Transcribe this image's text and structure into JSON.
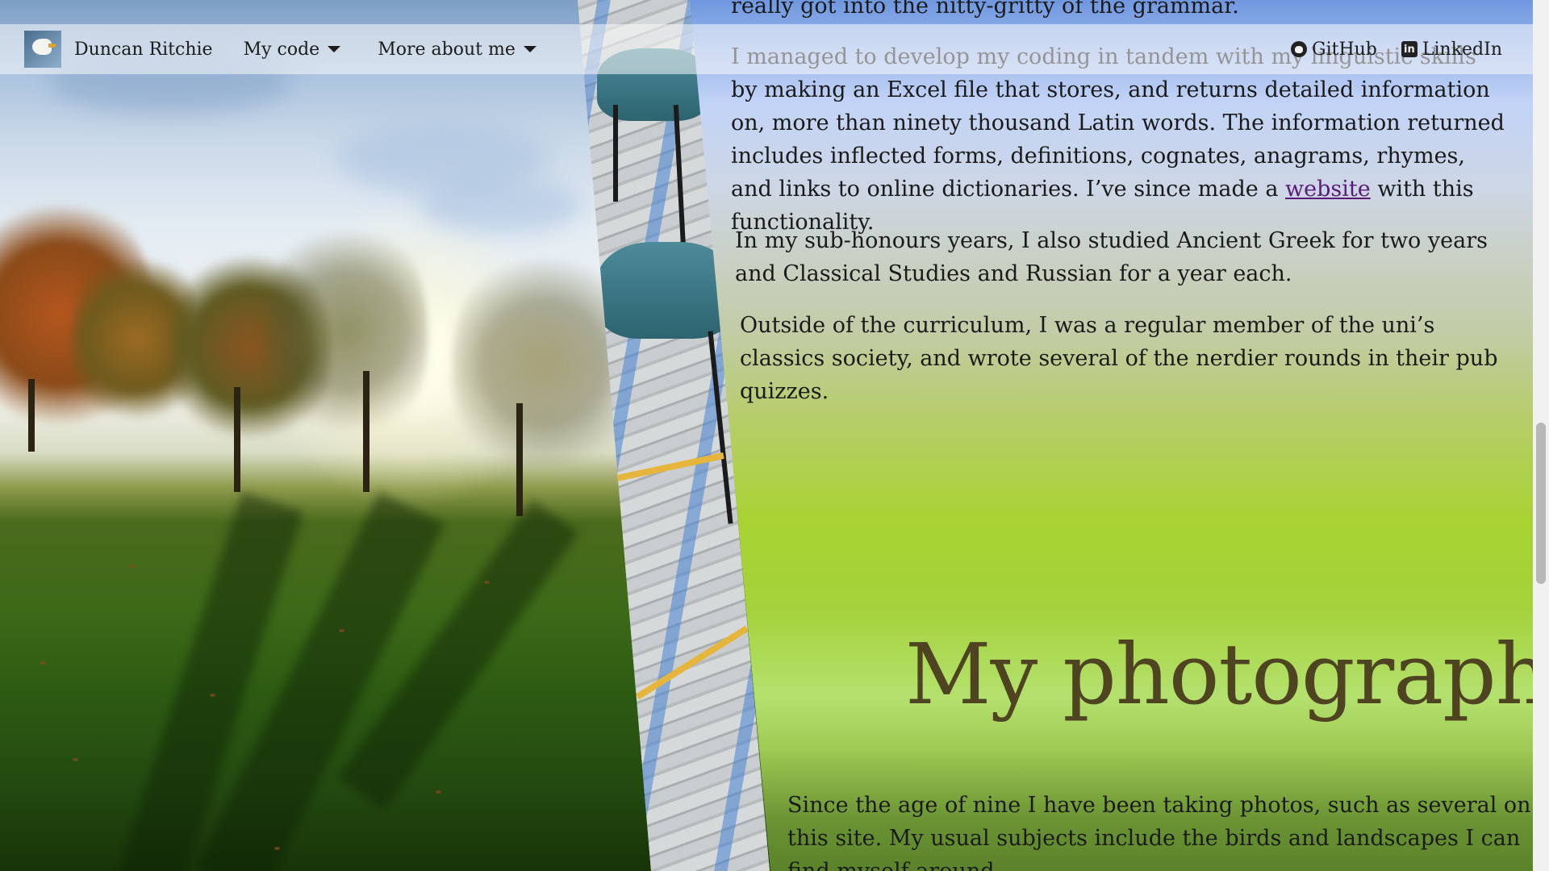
{
  "nav": {
    "brand": "Duncan Ritchie",
    "menu_code": "My code",
    "menu_about": "More about me",
    "github": "GitHub",
    "linkedin": "LinkedIn"
  },
  "content": {
    "p_top": "really got into the nitty-gritty of the grammar.",
    "p_excel_a": "I managed to develop my coding in tandem with my linguistic skills by making an Excel file that stores, and returns detailed information on, more than ninety thousand Latin words. The information returned includes inflected forms, definitions, cognates, anagrams, rhymes, and links to online dictionaries. I’ve since made a ",
    "p_excel_link": "website",
    "p_excel_b": " with this functionality.",
    "p_subhonours": "In my sub-honours years, I also studied Ancient Greek for two years and Classical Studies and Russian for a year each.",
    "p_society": "Outside of the curriculum, I was a regular member of the uni’s classics society, and wrote several of the nerdier rounds in their pub quizzes.",
    "heading_photography": "My photography.",
    "p_photos": "Since the age of nine I have been taking photos, such as several on this site. My usual subjects include the birds and landscapes I can find myself around."
  },
  "icons": {
    "logo": "bird-logo-icon",
    "github": "github-icon",
    "linkedin": "linkedin-icon",
    "caret": "caret-down-icon"
  },
  "colors": {
    "link": "#5a1a7a",
    "heading": "#4f4422"
  }
}
